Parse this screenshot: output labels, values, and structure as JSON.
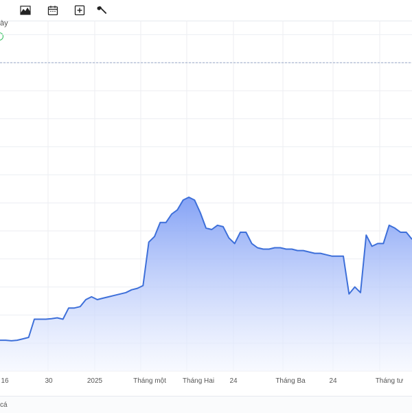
{
  "toolbar": {
    "tools": [
      {
        "name": "area-chart-icon"
      },
      {
        "name": "calendar-icon"
      },
      {
        "name": "add-box-icon"
      },
      {
        "name": "wrench-icon"
      }
    ]
  },
  "legend": {
    "label": "ày",
    "color": "#2fbf5a"
  },
  "footer": {
    "text": "cá"
  },
  "colors": {
    "line": "#3d6fd9",
    "fill_top": "#7f9ef5",
    "fill_bottom": "#f3f6ff",
    "grid": "#eceef2",
    "reference": "#9aa7c7"
  },
  "chart_data": {
    "type": "area",
    "title": "",
    "xlabel": "",
    "ylabel": "",
    "grid": true,
    "legend": "top-left",
    "x_tick_labels": [
      "16",
      "30",
      "2025",
      "Tháng một",
      "Tháng Hai",
      "24",
      "Tháng Ba",
      "24",
      "Tháng tư"
    ],
    "reference_line": 11,
    "ylim": [
      0,
      12.5
    ],
    "series": [
      {
        "values": [
          1.1,
          1.1,
          1.08,
          1.1,
          1.15,
          1.2,
          1.85,
          1.85,
          1.85,
          1.87,
          1.9,
          1.85,
          2.25,
          2.25,
          2.3,
          2.55,
          2.65,
          2.55,
          2.6,
          2.65,
          2.7,
          2.75,
          2.8,
          2.9,
          2.95,
          3.05,
          4.6,
          4.8,
          5.3,
          5.3,
          5.6,
          5.75,
          6.1,
          6.2,
          6.1,
          5.65,
          5.1,
          5.05,
          5.2,
          5.15,
          4.75,
          4.55,
          4.95,
          4.95,
          4.55,
          4.4,
          4.35,
          4.35,
          4.4,
          4.4,
          4.35,
          4.35,
          4.3,
          4.3,
          4.25,
          4.2,
          4.2,
          4.15,
          4.1,
          4.1,
          4.1,
          2.75,
          3.0,
          2.8,
          4.85,
          4.45,
          4.55,
          4.55,
          5.2,
          5.1,
          4.95,
          4.95,
          4.7
        ]
      }
    ]
  }
}
